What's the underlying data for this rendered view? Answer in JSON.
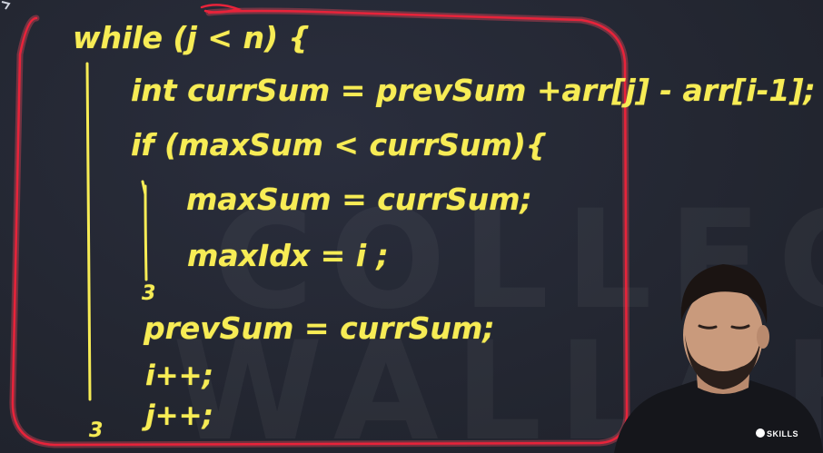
{
  "code_lines": {
    "l1": "while (j < n) {",
    "l2": "int currSum = prevSum +arr[j] - arr[i-1];",
    "l3": "if (maxSum < currSum){",
    "l4": "maxSum = currSum;",
    "l5": "maxIdx = i ;",
    "l6": "3",
    "l7": "prevSum = currSum;",
    "l8": "i++;",
    "l9": "j++;",
    "l10": "3"
  },
  "watermark": {
    "line1": "COLLEGE",
    "line2": "WALLAH"
  },
  "presenter_badge": "SKILLS",
  "colors": {
    "ink": "#f7ec55",
    "highlight": "#e8233a",
    "background": "#232634"
  }
}
